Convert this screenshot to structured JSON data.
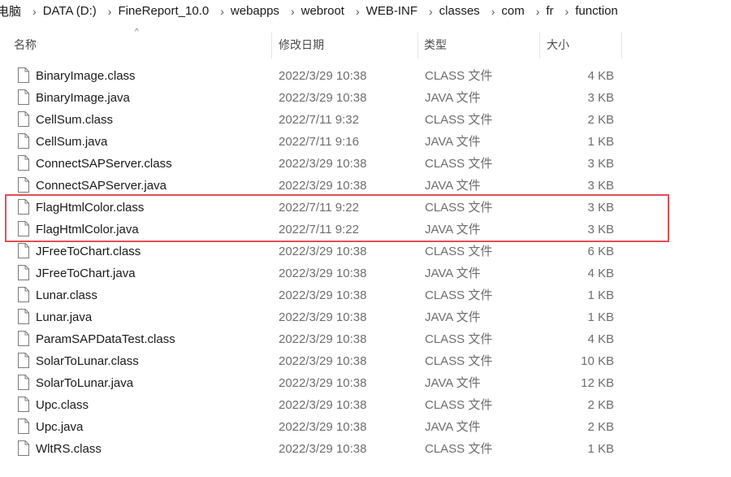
{
  "breadcrumb": [
    "电脑",
    "DATA (D:)",
    "FineReport_10.0",
    "webapps",
    "webroot",
    "WEB-INF",
    "classes",
    "com",
    "fr",
    "function"
  ],
  "columns": {
    "name": "名称",
    "date": "修改日期",
    "type": "类型",
    "size": "大小"
  },
  "files": [
    {
      "name": "BinaryImage.class",
      "date": "2022/3/29 10:38",
      "type": "CLASS 文件",
      "size": "4 KB"
    },
    {
      "name": "BinaryImage.java",
      "date": "2022/3/29 10:38",
      "type": "JAVA 文件",
      "size": "3 KB"
    },
    {
      "name": "CellSum.class",
      "date": "2022/7/11 9:32",
      "type": "CLASS 文件",
      "size": "2 KB"
    },
    {
      "name": "CellSum.java",
      "date": "2022/7/11 9:16",
      "type": "JAVA 文件",
      "size": "1 KB"
    },
    {
      "name": "ConnectSAPServer.class",
      "date": "2022/3/29 10:38",
      "type": "CLASS 文件",
      "size": "3 KB"
    },
    {
      "name": "ConnectSAPServer.java",
      "date": "2022/3/29 10:38",
      "type": "JAVA 文件",
      "size": "3 KB"
    },
    {
      "name": "FlagHtmlColor.class",
      "date": "2022/7/11 9:22",
      "type": "CLASS 文件",
      "size": "3 KB"
    },
    {
      "name": "FlagHtmlColor.java",
      "date": "2022/7/11 9:22",
      "type": "JAVA 文件",
      "size": "3 KB"
    },
    {
      "name": "JFreeToChart.class",
      "date": "2022/3/29 10:38",
      "type": "CLASS 文件",
      "size": "6 KB"
    },
    {
      "name": "JFreeToChart.java",
      "date": "2022/3/29 10:38",
      "type": "JAVA 文件",
      "size": "4 KB"
    },
    {
      "name": "Lunar.class",
      "date": "2022/3/29 10:38",
      "type": "CLASS 文件",
      "size": "1 KB"
    },
    {
      "name": "Lunar.java",
      "date": "2022/3/29 10:38",
      "type": "JAVA 文件",
      "size": "1 KB"
    },
    {
      "name": "ParamSAPDataTest.class",
      "date": "2022/3/29 10:38",
      "type": "CLASS 文件",
      "size": "4 KB"
    },
    {
      "name": "SolarToLunar.class",
      "date": "2022/3/29 10:38",
      "type": "CLASS 文件",
      "size": "10 KB"
    },
    {
      "name": "SolarToLunar.java",
      "date": "2022/3/29 10:38",
      "type": "JAVA 文件",
      "size": "12 KB"
    },
    {
      "name": "Upc.class",
      "date": "2022/3/29 10:38",
      "type": "CLASS 文件",
      "size": "2 KB"
    },
    {
      "name": "Upc.java",
      "date": "2022/3/29 10:38",
      "type": "JAVA 文件",
      "size": "2 KB"
    },
    {
      "name": "WltRS.class",
      "date": "2022/3/29 10:38",
      "type": "CLASS 文件",
      "size": "1 KB"
    }
  ],
  "highlight_color": "#e04f55",
  "file_icon": "file-icon"
}
